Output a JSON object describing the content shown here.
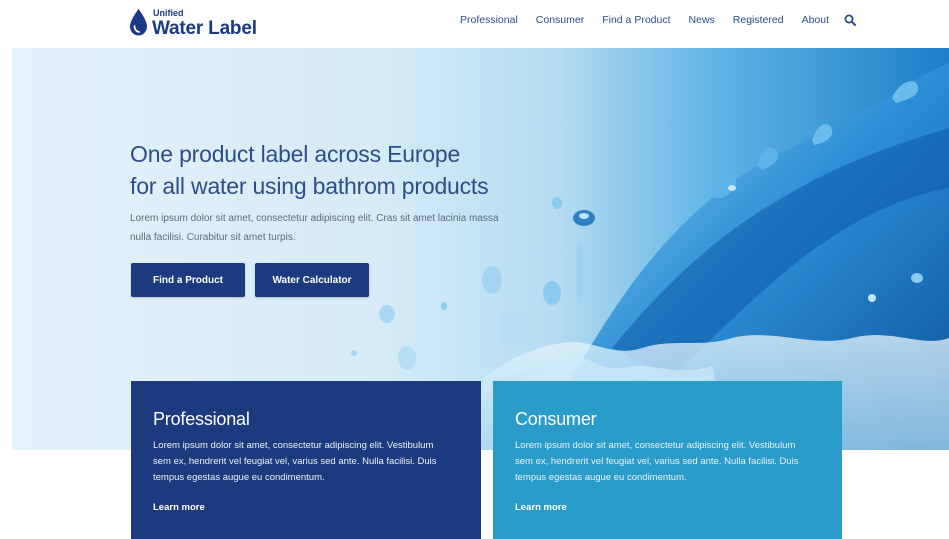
{
  "brand": {
    "small": "Unified",
    "big": "Water Label"
  },
  "nav": {
    "items": [
      "Professional",
      "Consumer",
      "Find a Product",
      "News",
      "Registered",
      "About"
    ],
    "search_icon": "search-icon"
  },
  "hero": {
    "title_line1": "One product label across Europe",
    "title_line2": "for all water using bathrom products",
    "text_line1": "Lorem ipsum dolor sit amet, consectetur adipiscing elit. Cras sit amet lacinia massa",
    "text_line2": "nulla facilisi. Curabitur sit amet turpis.",
    "button_find": "Find a Product",
    "button_calc": "Water Calculator"
  },
  "cards": {
    "professional": {
      "title": "Professional",
      "line1": "Lorem ipsum dolor sit amet, consectetur adipiscing elit. Vestibulum",
      "line2": "sem ex, hendrerit vel feugiat vel, varius sed ante. Nulla facilisi. Duis",
      "line3": "tempus egestas augue eu condimentum.",
      "link": "Learn more"
    },
    "consumer": {
      "title": "Consumer",
      "line1": "Lorem ipsum dolor sit amet, consectetur adipiscing elit. Vestibulum",
      "line2": "sem ex, hendrerit vel feugiat vel, varius sed ante. Nulla facilisi. Duis",
      "line3": "tempus egestas augue eu condimentum.",
      "link": "Learn more"
    }
  },
  "colors": {
    "brand_blue": "#1e3a7e",
    "consumer_blue": "#2a9cc9",
    "nav_text": "#2a4f8c"
  }
}
